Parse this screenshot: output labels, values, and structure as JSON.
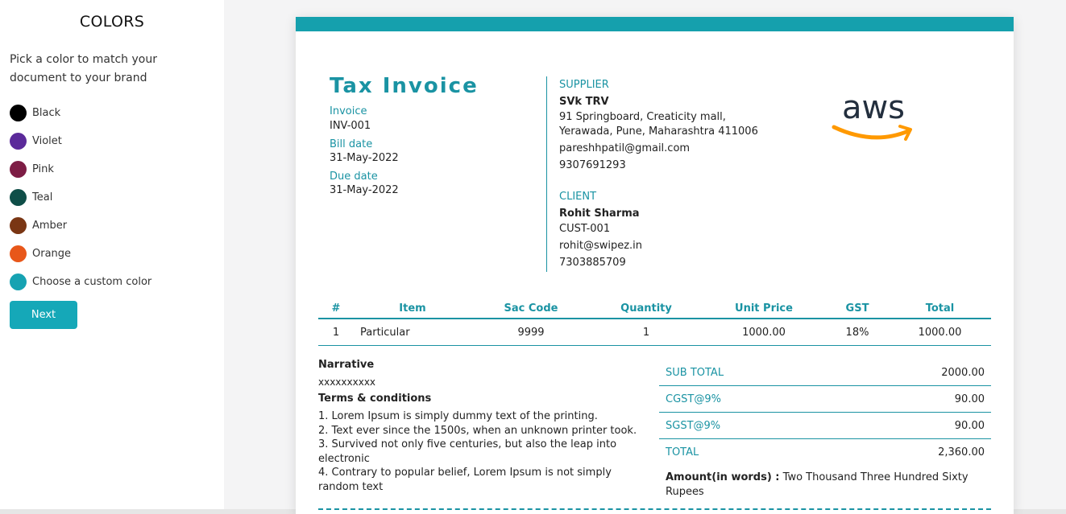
{
  "sidebar": {
    "title": "COLORS",
    "description": "Pick a color to match your document to your brand",
    "colors": [
      {
        "label": "Black",
        "color": "#000000"
      },
      {
        "label": "Violet",
        "color": "#5b2a9a"
      },
      {
        "label": "Pink",
        "color": "#7d1d45"
      },
      {
        "label": "Teal",
        "color": "#0f4e48"
      },
      {
        "label": "Amber",
        "color": "#7a3614"
      },
      {
        "label": "Orange",
        "color": "#e8571a"
      },
      {
        "label": "Choose a custom color",
        "color": "#16a2b2"
      }
    ],
    "next_label": "Next"
  },
  "theme": {
    "accent": "#1a93a3",
    "header_bar": "#15a0ad"
  },
  "invoice": {
    "title": "Tax Invoice",
    "invoice_label": "Invoice",
    "invoice_number": "INV-001",
    "bill_date_label": "Bill date",
    "bill_date": "31-May-2022",
    "due_date_label": "Due date",
    "due_date": "31-May-2022",
    "supplier": {
      "label": "SUPPLIER",
      "name": "SVk TRV",
      "address1": "91 Springboard, Creaticity mall,",
      "address2": "Yerawada, Pune, Maharashtra 411006",
      "email": "pareshhpatil@gmail.com",
      "phone": "9307691293"
    },
    "client": {
      "label": "CLIENT",
      "name": "Rohit Sharma",
      "id": "CUST-001",
      "email": "rohit@swipez.in",
      "phone": "7303885709"
    },
    "logo": {
      "text": "aws",
      "icon": "aws-logo-icon"
    },
    "table": {
      "headers": [
        "#",
        "Item",
        "Sac Code",
        "Quantity",
        "Unit Price",
        "GST",
        "Total"
      ],
      "rows": [
        [
          "1",
          "Particular",
          "9999",
          "1",
          "1000.00",
          "18%",
          "1000.00"
        ]
      ]
    },
    "narrative_label": "Narrative",
    "narrative": "xxxxxxxxxx",
    "terms_label": "Terms & conditions",
    "terms": [
      "1. Lorem Ipsum is simply dummy text of the printing.",
      "2. Text ever since the 1500s, when an unknown printer took.",
      "3. Survived not only five centuries, but also the leap into electronic",
      "4. Contrary to popular belief, Lorem Ipsum is not simply random text"
    ],
    "totals": [
      {
        "label": "SUB TOTAL",
        "value": "2000.00"
      },
      {
        "label": "CGST@9%",
        "value": "90.00"
      },
      {
        "label": "SGST@9%",
        "value": "90.00"
      },
      {
        "label": "TOTAL",
        "value": "2,360.00"
      }
    ],
    "amount_words_label": "Amount(in words) :",
    "amount_words": "Two Thousand Three Hundred Sixty Rupees"
  }
}
